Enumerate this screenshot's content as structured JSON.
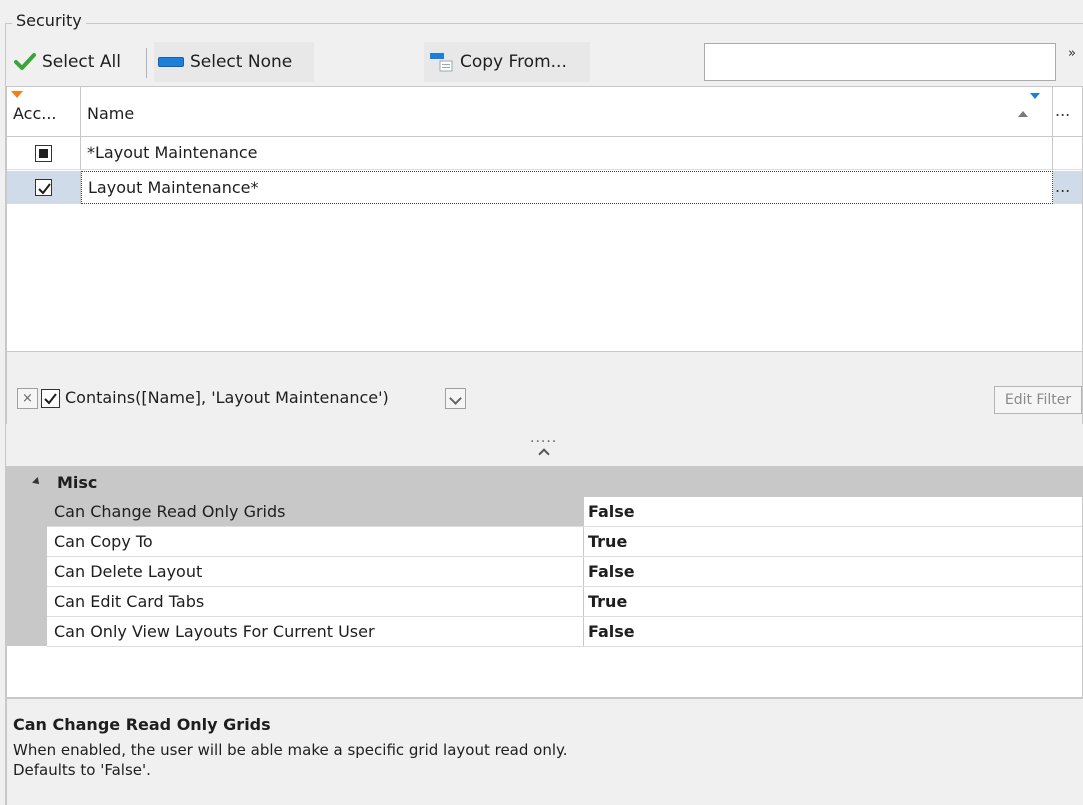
{
  "group": {
    "title": "Security"
  },
  "toolbar": {
    "select_all": "Select All",
    "select_none": "Select None",
    "copy_from": "Copy From...",
    "search_value": "",
    "overflow": "»"
  },
  "grid": {
    "columns": {
      "access": "Acc...",
      "name": "Name",
      "more": "..."
    },
    "rows": [
      {
        "access_state": "indeterminate",
        "name": "*Layout Maintenance",
        "selected": false
      },
      {
        "access_state": "checked",
        "name": "Layout Maintenance*",
        "selected": true,
        "more": "..."
      }
    ]
  },
  "filter": {
    "expression": "Contains([Name], 'Layout Maintenance')",
    "enabled": true,
    "edit_label": "Edit Filter",
    "clear_symbol": "×"
  },
  "splitter": {
    "dots": "....."
  },
  "properties": {
    "category": "Misc",
    "items": [
      {
        "name": "Can Change Read Only Grids",
        "value": "False"
      },
      {
        "name": "Can Copy To",
        "value": "True"
      },
      {
        "name": "Can Delete Layout",
        "value": "False"
      },
      {
        "name": "Can Edit Card Tabs",
        "value": "True"
      },
      {
        "name": "Can Only View Layouts For Current User",
        "value": "False"
      }
    ]
  },
  "description": {
    "title": "Can Change Read Only Grids",
    "line1": "When enabled, the user will be able make a specific grid layout read only.",
    "line2": "Defaults to 'False'."
  },
  "colors": {
    "accent": "#1e7fd8",
    "check_green": "#3aa53a",
    "filter_orange": "#f0801e"
  }
}
